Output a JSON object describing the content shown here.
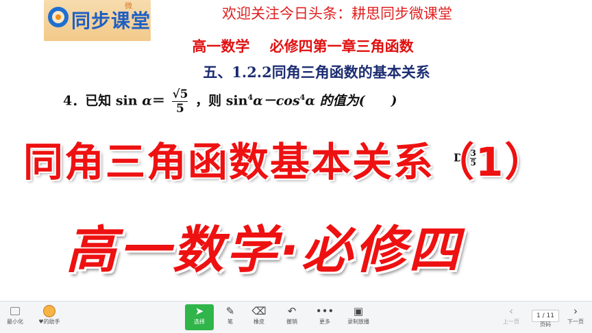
{
  "logo": {
    "text": "同步课堂",
    "mini": "微"
  },
  "header": {
    "welcome": "欢迎关注今日头条：耕思同步微课堂",
    "course": "高一数学    必修四第一章三角函数",
    "section": "五、1.2.2同角三角函数的基本关系"
  },
  "question": {
    "prefix": "4．已知 sin",
    "alpha": "α",
    "eq": "＝",
    "num": "√5",
    "den": "5",
    "mid": "，则 sin",
    "pow4": "4",
    "minus": "α－cos",
    "end": "α 的值为(　　)"
  },
  "overlay": {
    "title": "同角三角函数基本关系（1）",
    "subtitle": "高一数学·必修四",
    "option_d": "D.",
    "option_d_num": "3",
    "option_d_den": "5"
  },
  "toolbar": {
    "minimize": "最小化",
    "helper": "♥的助手",
    "select": "选择",
    "pen": "笔",
    "eraser": "橡皮",
    "undo": "撤销",
    "more": "更多",
    "record": "录制放播",
    "prev": "上一页",
    "page_label": "页码",
    "page_value": "1 / 11",
    "next": "下一页"
  }
}
